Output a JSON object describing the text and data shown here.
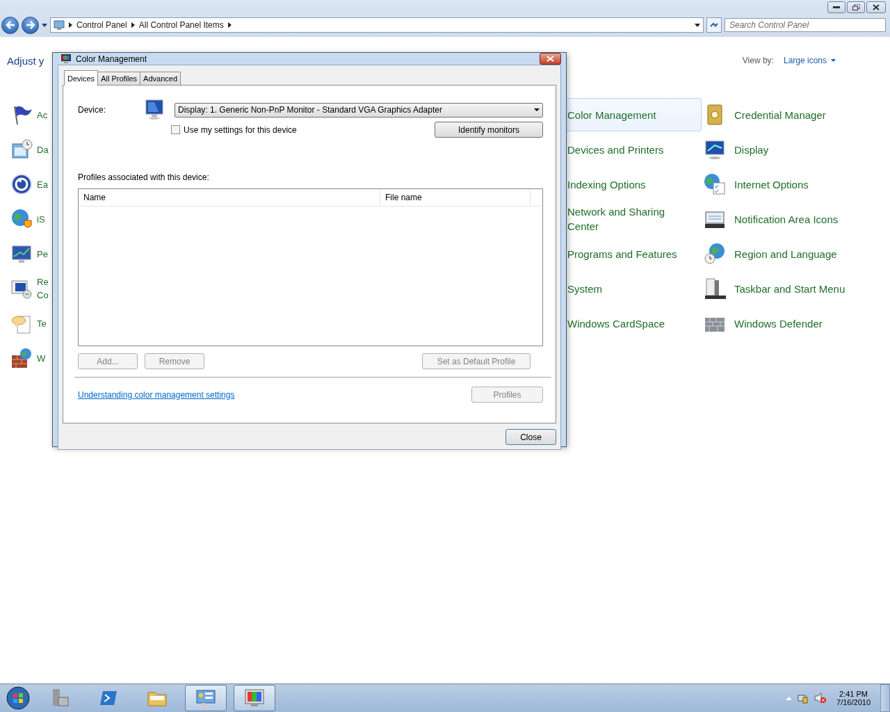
{
  "address_bar": {
    "breadcrumbs": [
      "Control Panel",
      "All Control Panel Items"
    ],
    "search": {
      "placeholder": "Search Control Panel"
    }
  },
  "header": {
    "title": "Adjust y",
    "view_by_label": "View by:",
    "view_by_value": "Large icons"
  },
  "columns": [
    {
      "items": [
        {
          "text": "Ac",
          "hovered": false
        },
        {
          "text": "Da",
          "hovered": false
        },
        {
          "text": "Ea",
          "hovered": false
        },
        {
          "text": "iS",
          "hovered": false
        },
        {
          "text": "Pe",
          "hovered": false
        },
        {
          "text": "Re\nCo",
          "hovered": false
        },
        {
          "text": "Te",
          "hovered": false
        },
        {
          "text": "W",
          "hovered": false
        }
      ]
    },
    {
      "items": [
        {
          "text": "Color Management",
          "hovered": true
        },
        {
          "text": "Devices and Printers",
          "hovered": false
        },
        {
          "text": "Indexing Options",
          "hovered": false
        },
        {
          "text": "Network and Sharing Center",
          "hovered": false
        },
        {
          "text": "Programs and Features",
          "hovered": false
        },
        {
          "text": "System",
          "hovered": false
        },
        {
          "text": "Windows CardSpace",
          "hovered": false
        }
      ]
    },
    {
      "items": [
        {
          "text": "Credential Manager",
          "hovered": false
        },
        {
          "text": "Display",
          "hovered": false
        },
        {
          "text": "Internet Options",
          "hovered": false
        },
        {
          "text": "Notification Area Icons",
          "hovered": false
        },
        {
          "text": "Region and Language",
          "hovered": false
        },
        {
          "text": "Taskbar and Start Menu",
          "hovered": false
        },
        {
          "text": "Windows Defender",
          "hovered": false
        }
      ]
    }
  ],
  "dialog": {
    "title": "Color Management",
    "tabs": [
      {
        "label": "Devices",
        "selected": true
      },
      {
        "label": "All Profiles",
        "selected": false
      },
      {
        "label": "Advanced",
        "selected": false
      }
    ],
    "device_label": "Device:",
    "device_value": "Display: 1. Generic Non-PnP Monitor - Standard VGA Graphics Adapter",
    "use_my_settings": {
      "label": "Use my settings for this device",
      "checked": false
    },
    "identify_button": {
      "label": "Identify monitors",
      "disabled": false
    },
    "profiles_label": "Profiles associated with this device:",
    "table": {
      "columns": [
        "Name",
        "File name"
      ]
    },
    "list_buttons": [
      {
        "label": "Add...",
        "disabled": true
      },
      {
        "label": "Remove",
        "disabled": true
      },
      {
        "label": "Set as Default Profile",
        "disabled": true
      }
    ],
    "link": "Understanding color management settings",
    "profiles_button": {
      "label": "Profiles",
      "disabled": true
    },
    "close_button": {
      "label": "Close",
      "disabled": false
    }
  },
  "taskbar": {
    "apps": [
      {
        "selected": false
      },
      {
        "selected": false
      },
      {
        "selected": false
      },
      {
        "selected": true
      },
      {
        "selected": true
      }
    ],
    "time": "2:41 PM",
    "date": "7/16/2010"
  }
}
